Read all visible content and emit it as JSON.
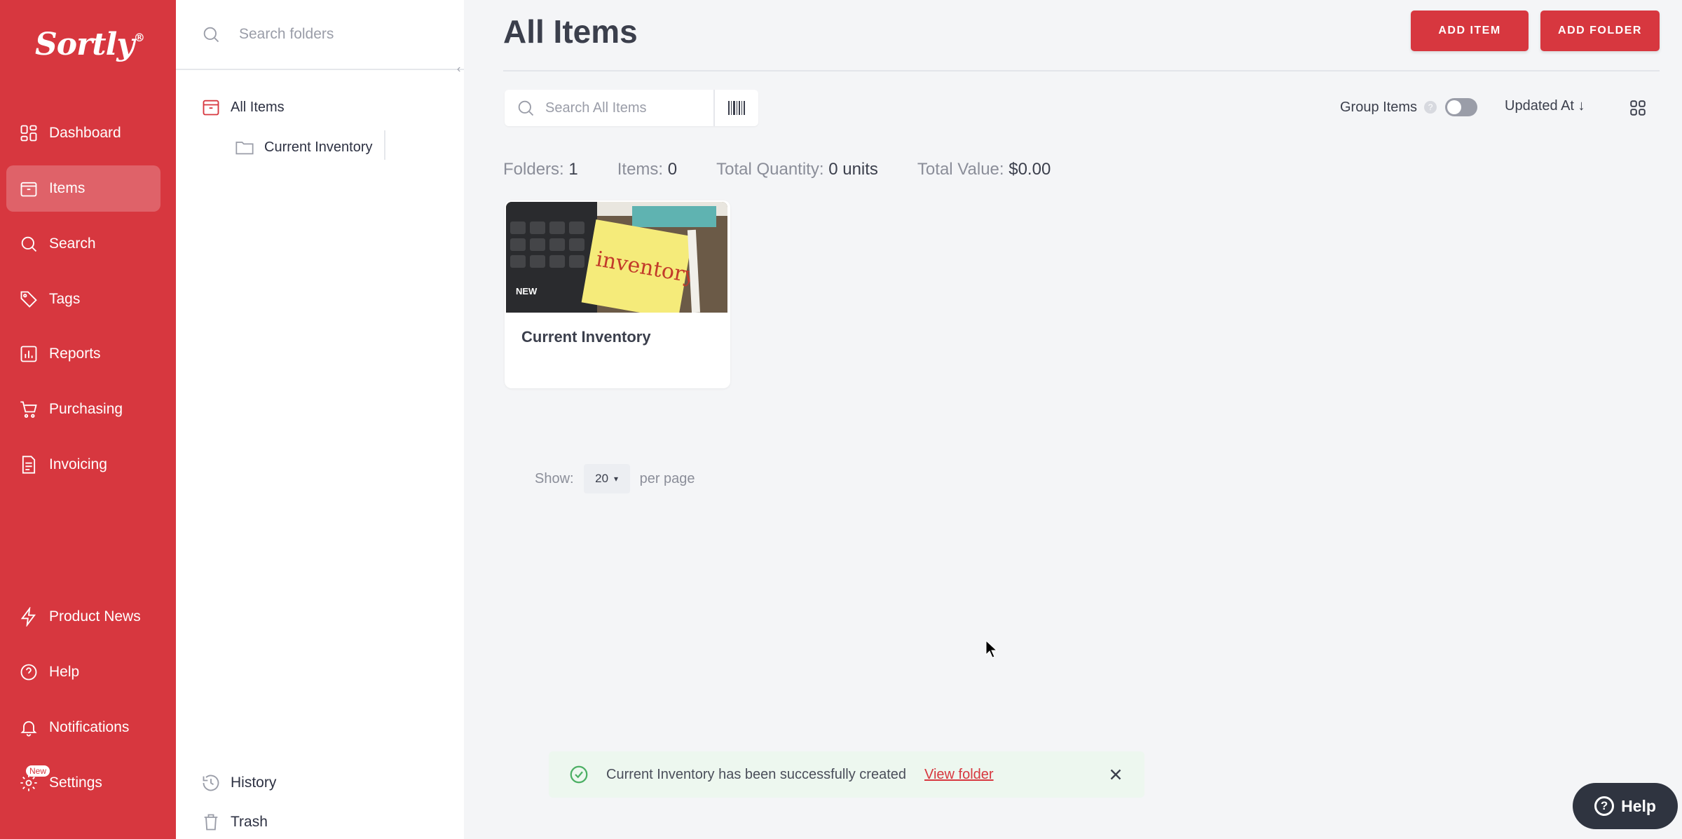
{
  "colors": {
    "brand": "#d7373f",
    "text": "#2d3142",
    "muted": "#8b8e99",
    "success_bg": "#edf7ef"
  },
  "nav": {
    "logo": "Sortly",
    "logo_mark": "®",
    "items": [
      {
        "label": "Dashboard",
        "icon": "dashboard-icon"
      },
      {
        "label": "Items",
        "icon": "items-icon",
        "active": true
      },
      {
        "label": "Search",
        "icon": "search-icon"
      },
      {
        "label": "Tags",
        "icon": "tag-icon"
      },
      {
        "label": "Reports",
        "icon": "reports-icon"
      },
      {
        "label": "Purchasing",
        "icon": "cart-icon"
      },
      {
        "label": "Invoicing",
        "icon": "invoice-icon"
      }
    ],
    "bottom_items": [
      {
        "label": "Product News",
        "icon": "lightning-icon"
      },
      {
        "label": "Help",
        "icon": "help-icon"
      },
      {
        "label": "Notifications",
        "icon": "bell-icon"
      },
      {
        "label": "Settings",
        "icon": "gear-icon",
        "badge": "New"
      }
    ]
  },
  "folders": {
    "search_placeholder": "Search folders",
    "tree": [
      {
        "label": "All Items",
        "icon": "box-icon"
      },
      {
        "label": "Current Inventory",
        "icon": "folder-icon"
      }
    ],
    "history_label": "History",
    "trash_label": "Trash"
  },
  "main": {
    "title": "All Items",
    "add_item": "ADD ITEM",
    "add_folder": "ADD FOLDER",
    "search_placeholder": "Search All Items",
    "group_items": "Group Items",
    "sort_label": "Updated At",
    "sort_arrow": "↓",
    "stats": {
      "folders_label": "Folders:",
      "folders_value": "1",
      "items_label": "Items:",
      "items_value": "0",
      "qty_label": "Total Quantity:",
      "qty_value": "0 units",
      "value_label": "Total Value:",
      "value_value": "$0.00"
    },
    "card": {
      "title": "Current Inventory",
      "tag": "NEW",
      "image_text": "inventory"
    },
    "pager": {
      "show": "Show:",
      "per_page_value": "20",
      "per_page": "per page"
    }
  },
  "toast": {
    "message": "Current Inventory has been successfully created",
    "link": "View folder"
  },
  "help_button": "Help"
}
